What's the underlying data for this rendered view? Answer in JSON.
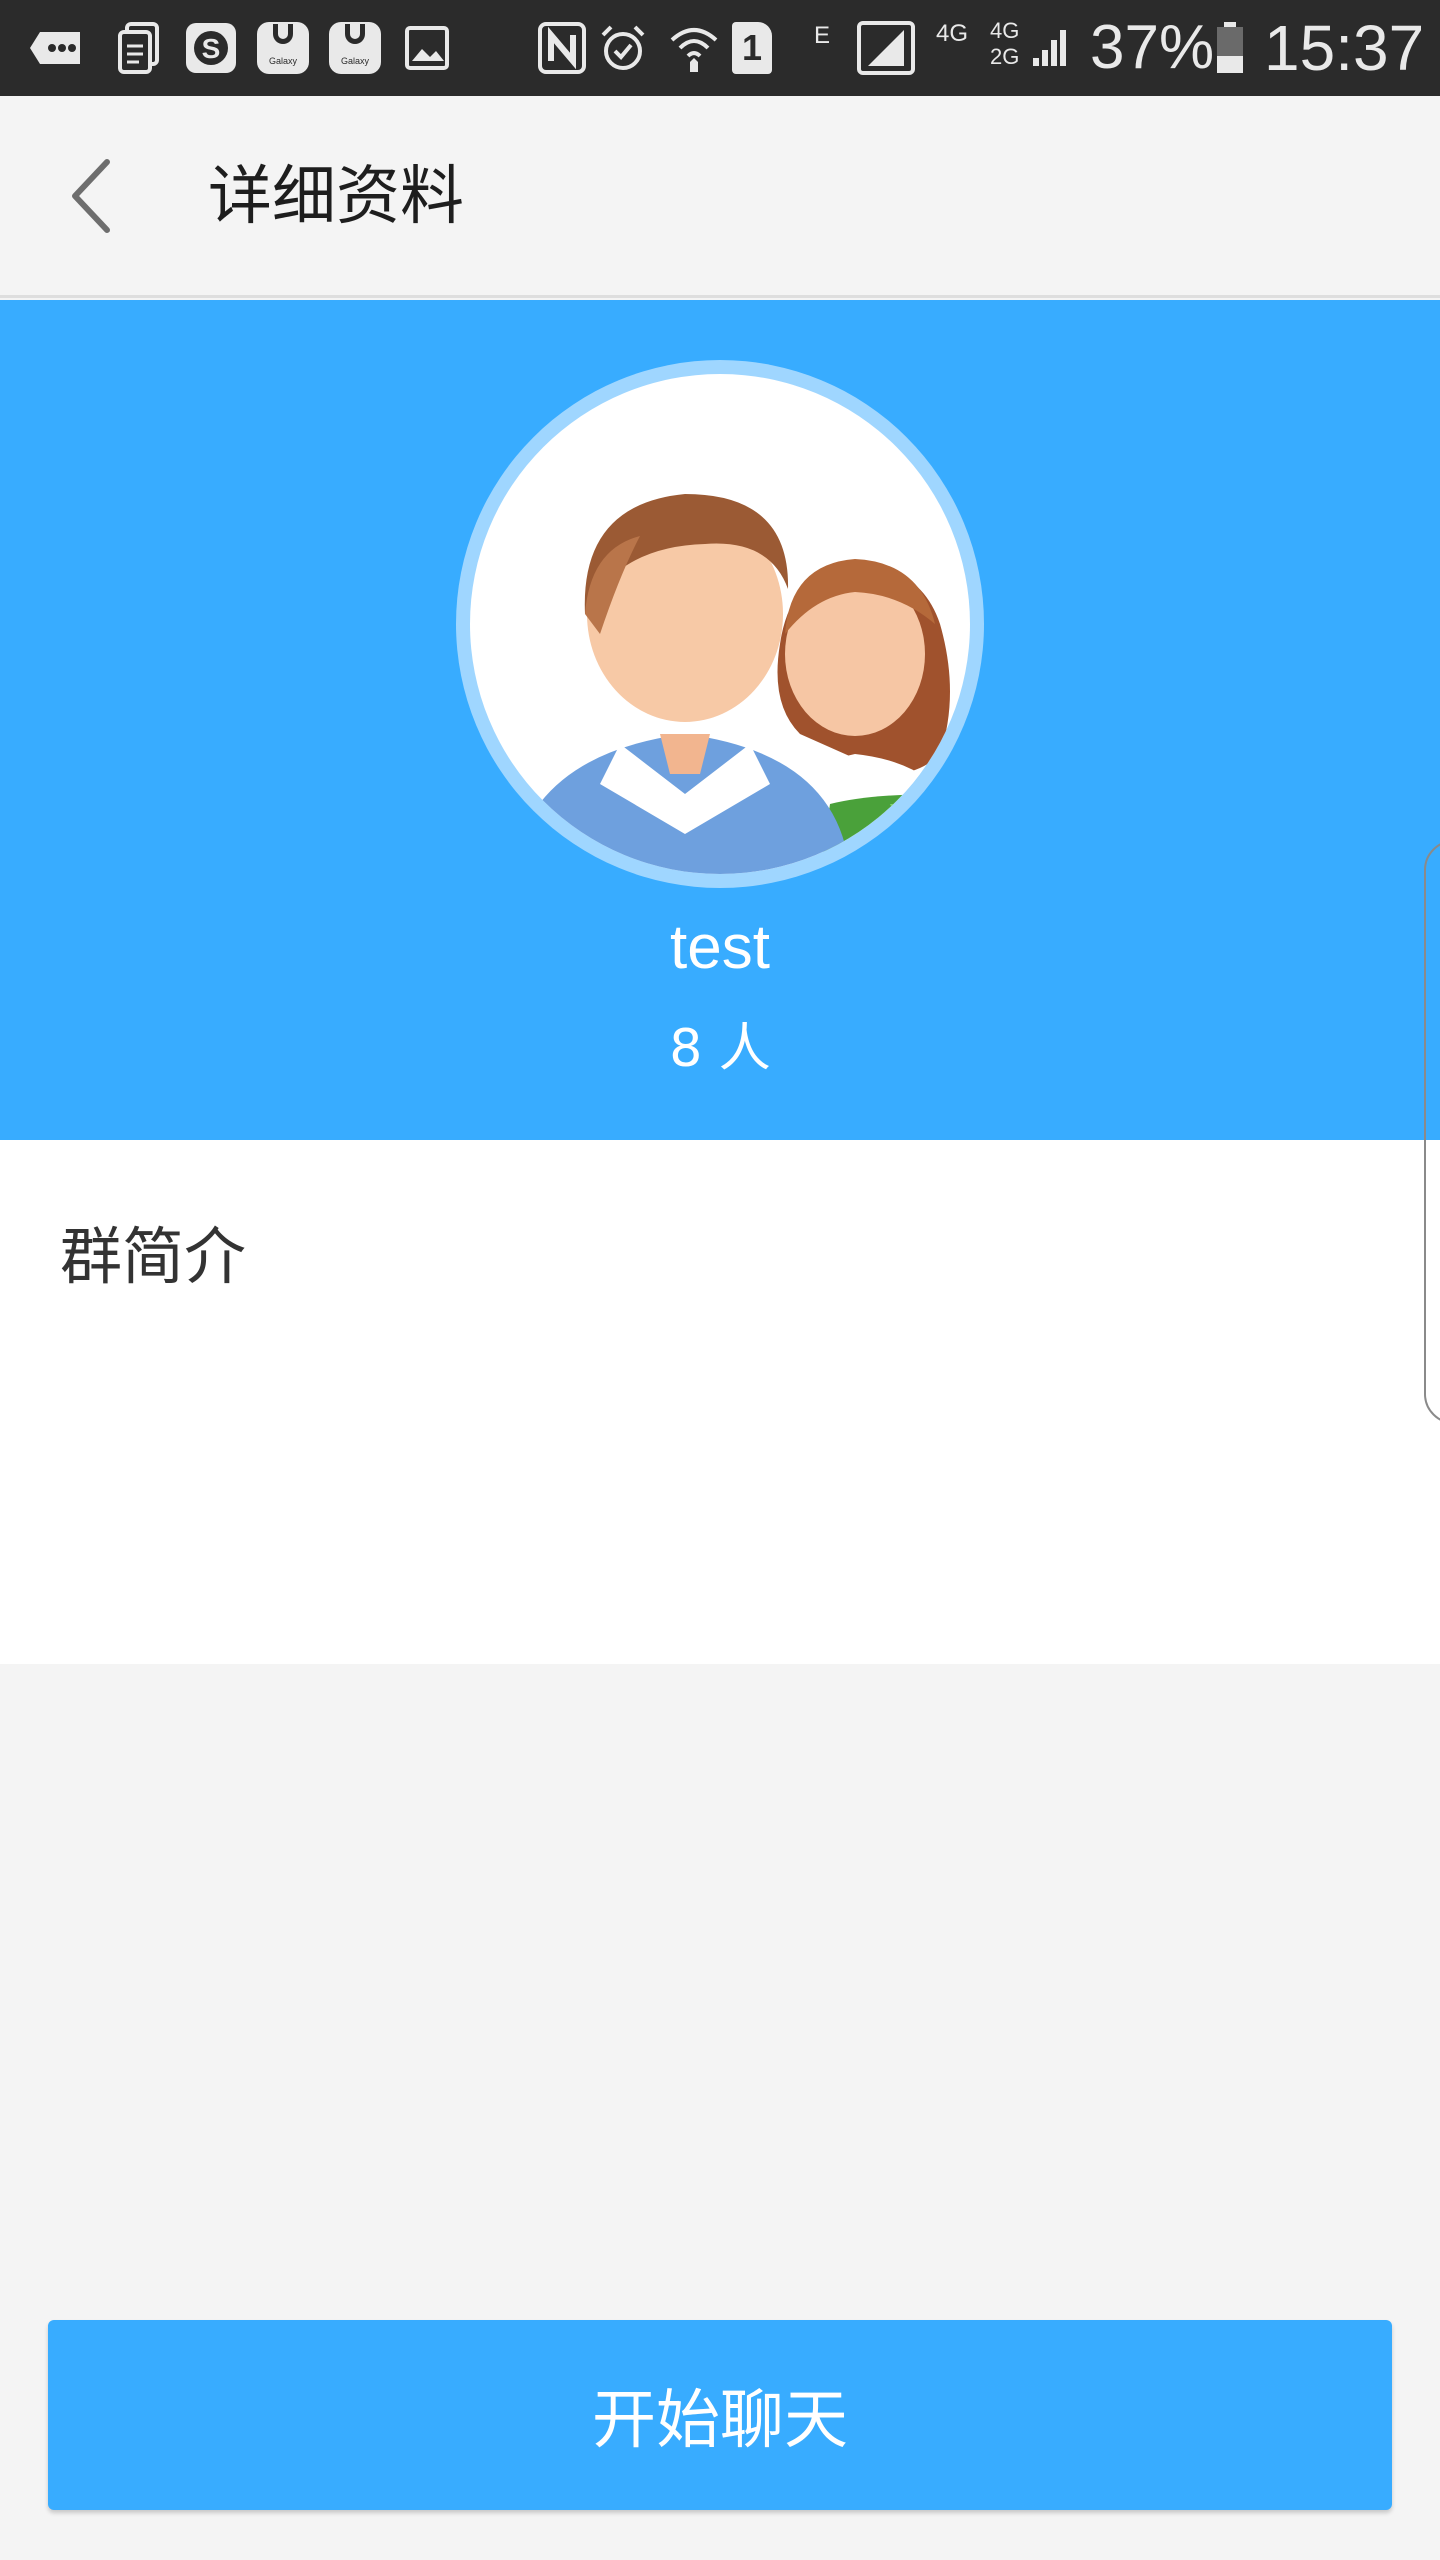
{
  "status_bar": {
    "signal_left": "E",
    "sim_slot": "1",
    "network_4g": "4G",
    "network_4g_2g_top": "4G",
    "network_4g_2g_bottom": "2G",
    "battery": "37%",
    "time": "15:37",
    "galaxy_1": "Galaxy",
    "galaxy_2": "Galaxy",
    "icons": [
      "message-icon",
      "clipboard-icon",
      "dollar-app-icon",
      "galaxy-app-icon",
      "galaxy-app-icon",
      "image-icon",
      "nfc-icon",
      "alarm-icon",
      "wifi-icon",
      "sim-icon",
      "cell-signal-icon",
      "cell-signal-icon",
      "battery-icon"
    ]
  },
  "app_bar": {
    "title": "详细资料",
    "back_icon": "chevron-left-icon"
  },
  "group": {
    "name": "test",
    "member_count": "8 人",
    "avatar_icon": "group-avatar-icon"
  },
  "intro": {
    "label": "群简介"
  },
  "actions": {
    "start_chat": "开始聊天"
  },
  "colors": {
    "accent": "#38acff",
    "status_bar": "#2b2b2b",
    "background": "#f4f4f4"
  }
}
